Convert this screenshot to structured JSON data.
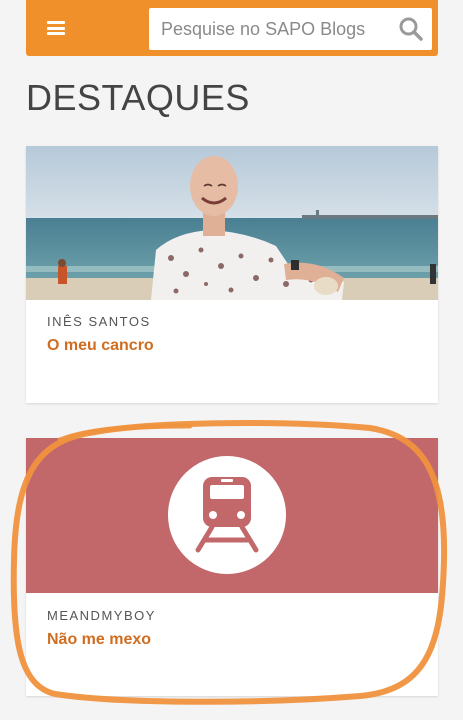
{
  "header": {
    "search_placeholder": "Pesquise no SAPO Blogs",
    "menu_icon": "hamburger-menu-icon",
    "search_icon": "search-icon",
    "accent_color": "#f0902b"
  },
  "page": {
    "heading": "DESTAQUES"
  },
  "featured": [
    {
      "author": "INÊS SANTOS",
      "title": "O meu cancro",
      "image": "photo of smiling bald woman at the beach"
    },
    {
      "author": "MEANDMYBOY",
      "title": "Não me mexo",
      "image_icon": "train-icon",
      "image_bg_color": "#c2686a"
    }
  ],
  "annotation": {
    "color": "#f0923e"
  }
}
